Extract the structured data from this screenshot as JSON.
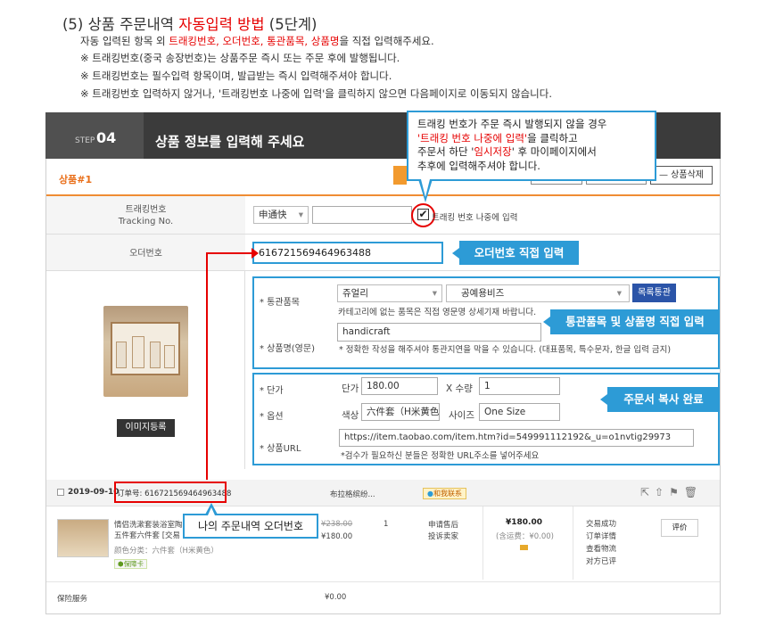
{
  "header": {
    "title_prefix": "(5) 상품 주문내역 ",
    "title_highlight": "자동입력 방법",
    "title_suffix": " (5단계)",
    "line1_prefix": "자동 입력된 항목 외 ",
    "line1_highlight": "트래킹번호, 오더번호, 통관품목, 상품명",
    "line1_suffix": "을 직접 입력해주세요.",
    "line2": "※ 트래킹번호(중국 송장번호)는 상품주문 즉시 또는 주문 후에 발행됩니다.",
    "line3": "※ 트래킹번호는 필수입력 항목이며, 발급받는 즉시 입력해주셔야 합니다.",
    "line4": "※ 트래킹번호 입력하지 않거나, '트래킹번호 나중에 입력'을 클릭하지 않으면 다음페이지로 이동되지 않습니다."
  },
  "step": {
    "label": "STEP",
    "number": "04",
    "title": "상품 정보를 입력해 주세요"
  },
  "product": {
    "number_label": "상품#1",
    "delete_label": "— 상품삭제"
  },
  "tracking": {
    "label_ko": "트래킹번호",
    "label_en": "Tracking No.",
    "carrier": "申通快",
    "later_label": "트래킹 번호 나중에 입력"
  },
  "order": {
    "label": "오더번호",
    "value": "616721569464963488"
  },
  "customs": {
    "label": "* 통관품목",
    "category": "쥬얼리",
    "subcategory": "공예용비즈",
    "button": "목록통관",
    "note": "카테고리에 없는 품목은 직접 영문명 상세기재 바랍니다."
  },
  "product_name": {
    "label": "* 상품명(영문)",
    "value": "handicraft",
    "note": "* 정확한 작성을 해주셔야 통관지연을 막을 수 있습니다. (대표품목, 특수문자, 한글 입력 금지)"
  },
  "image_button": "이미지등록",
  "price": {
    "label": "* 단가",
    "price_label": "단가",
    "price_value": "180.00",
    "qty_label": "X 수량",
    "qty_value": "1"
  },
  "option": {
    "label": "* 옵션",
    "color_label": "색상",
    "color_value": "六件套（H米黄色）",
    "size_label": "사이즈",
    "size_value": "One Size"
  },
  "url": {
    "label": "* 상품URL",
    "value": "https://item.taobao.com/item.htm?id=549991112192&_u=o1nvtig29973",
    "note": "*검수가 필요하신 분들은 정확한 URL주소를 넣어주세요"
  },
  "callouts": {
    "top_line1": "트래킹 번호가 주문 즉시 발행되지 않을 경우",
    "top_line2_hl": "'트래킹 번호 나중에 입력'",
    "top_line2_rest": "을 클릭하고",
    "top_line3_a": "주문서 하단 '",
    "top_line3_hl": "임시저장",
    "top_line3_b": "' 후 마이페이지에서",
    "top_line4": "추후에 입력해주셔야 합니다.",
    "order_direct": "오더번호 직접 입력",
    "customs_direct": "통관품목 및 상품명 직접 입력",
    "copy_done": "주문서 복사 완료",
    "my_order": "나의 주문내역 오더번호"
  },
  "taobao": {
    "date": "2019-09-10",
    "order_no": "订单号: 616721569464963488",
    "shop": "布拉格缤纷...",
    "contact": "和我联系",
    "item_title_1": "情侣洗漱套装浴室陶",
    "item_title_2": "五件套六件套 [交易",
    "item_attr": "颜色分类：六件套（H米黄色）",
    "item_badge": "保障卡",
    "old_price": "¥238.00",
    "new_price": "¥180.00",
    "qty": "1",
    "after_sale_1": "申请售后",
    "after_sale_2": "投诉卖家",
    "total": "¥180.00",
    "shipping": "(含运费：¥0.00)",
    "status_1": "交易成功",
    "status_2": "订单详情",
    "status_3": "查看物流",
    "status_4": "对方已评",
    "review": "评价",
    "service_label": "保险服务",
    "service_value": "¥0.00"
  },
  "colors": {
    "accent_red": "#e60000",
    "callout_blue": "#2d9bd6",
    "orange": "#ef8c33"
  }
}
